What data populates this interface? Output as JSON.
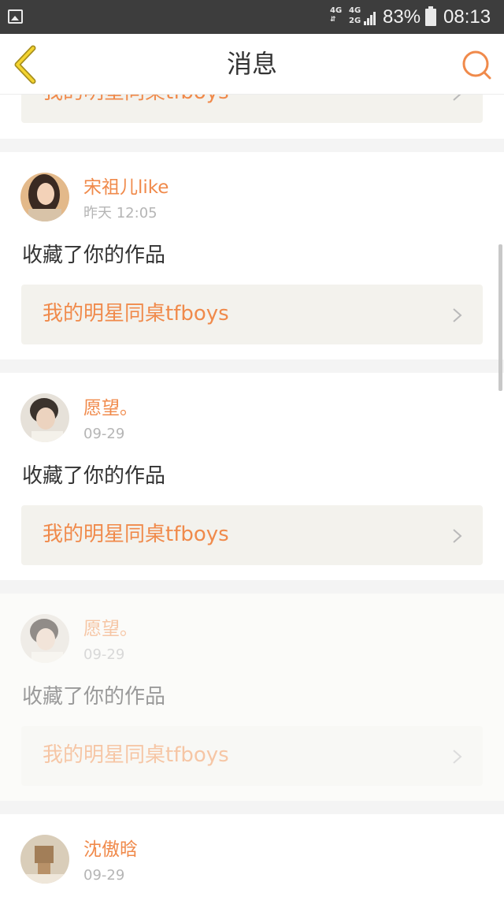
{
  "status_bar": {
    "network_a": [
      "4G",
      "⇵"
    ],
    "network_b": [
      "4G",
      "2G"
    ],
    "battery_percent": "83%",
    "time": "08:13",
    "icons": [
      "gallery-icon",
      "signal-icon",
      "battery-icon"
    ]
  },
  "nav": {
    "title": "消息",
    "back_icon": "chevron-left-icon",
    "search_icon": "search-icon",
    "accent_color": "#f08a4b"
  },
  "partial_item": {
    "work_title": "我的明星同桌tfboys"
  },
  "messages": [
    {
      "user": "宋祖儿like",
      "time": "昨天 12:05",
      "action": "收藏了你的作品",
      "work_title": "我的明星同桌tfboys"
    },
    {
      "user": "愿望。",
      "time": "09-29",
      "action": "收藏了你的作品",
      "work_title": "我的明星同桌tfboys"
    },
    {
      "user": "愿望。",
      "time": "09-29",
      "action": "收藏了你的作品",
      "work_title": "我的明星同桌tfboys"
    },
    {
      "user": "沈傲晗",
      "time": "09-29"
    }
  ]
}
